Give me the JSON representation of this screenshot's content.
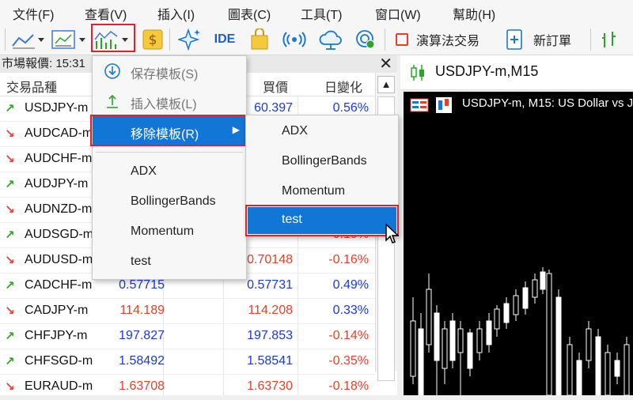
{
  "menubar": [
    "文件(F)",
    "查看(V)",
    "插入(I)",
    "圖表(C)",
    "工具(T)",
    "窗口(W)",
    "幫助(H)"
  ],
  "toolbar": {
    "ide_label": "IDE",
    "algo_label": "演算法交易",
    "new_order_label": "新訂單"
  },
  "market_watch": {
    "title": "市場報價: 15:31",
    "columns": [
      "交易品種",
      "買價",
      "日變化"
    ],
    "rows": [
      {
        "dir": "up",
        "symbol": "USDJPY-m",
        "bid": "",
        "ask": "60.397",
        "change": "0.56%",
        "bid_color": "blue",
        "change_color": "blue"
      },
      {
        "dir": "down",
        "symbol": "AUDCAD-m",
        "bid": "",
        "ask": "",
        "change": "",
        "bid_color": "red",
        "change_color": "red"
      },
      {
        "dir": "down",
        "symbol": "AUDCHF-m",
        "bid": "",
        "ask": "",
        "change": "",
        "bid_color": "red",
        "change_color": "red"
      },
      {
        "dir": "up",
        "symbol": "AUDJPY-m",
        "bid": "",
        "ask": "",
        "change": "",
        "bid_color": "blue",
        "change_color": "blue"
      },
      {
        "dir": "down",
        "symbol": "AUDNZD-m",
        "bid": "",
        "ask": "",
        "change": "",
        "bid_color": "red",
        "change_color": "red"
      },
      {
        "dir": "up",
        "symbol": "AUDSGD-m",
        "bid": "",
        "ask": "",
        "change": "0.19%",
        "bid_color": "blue",
        "change_color": "red"
      },
      {
        "dir": "down",
        "symbol": "AUDUSD-m",
        "bid": "",
        "ask": "0.70148",
        "change": "-0.16%",
        "bid_color": "red",
        "change_color": "red"
      },
      {
        "dir": "up",
        "symbol": "CADCHF-m",
        "bid": "0.57715",
        "ask": "0.57731",
        "change": "0.49%",
        "bid_color": "blue",
        "change_color": "blue"
      },
      {
        "dir": "down",
        "symbol": "CADJPY-m",
        "bid": "114.189",
        "ask": "114.208",
        "change": "0.33%",
        "bid_color": "red",
        "change_color": "blue"
      },
      {
        "dir": "up",
        "symbol": "CHFJPY-m",
        "bid": "197.827",
        "ask": "197.853",
        "change": "-0.14%",
        "bid_color": "blue",
        "change_color": "red"
      },
      {
        "dir": "up",
        "symbol": "CHFSGD-m",
        "bid": "1.58492",
        "ask": "1.58541",
        "change": "-0.35%",
        "bid_color": "blue",
        "change_color": "red"
      },
      {
        "dir": "down",
        "symbol": "EURAUD-m",
        "bid": "1.63708",
        "ask": "1.63730",
        "change": "-0.18%",
        "bid_color": "red",
        "change_color": "red"
      }
    ]
  },
  "template_menu": {
    "save": "保存模板(S)",
    "insert": "插入模板(L)",
    "remove": "移除模板(R)",
    "templates": [
      "ADX",
      "BollingerBands",
      "Momentum",
      "test"
    ]
  },
  "submenu": {
    "items": [
      "ADX",
      "BollingerBands",
      "Momentum",
      "test"
    ],
    "selected": "test"
  },
  "chart": {
    "tab_title": "USDJPY-m,M15",
    "header": "USDJPY-m, M15:  US Dollar vs J"
  },
  "colors": {
    "up": "#2aa52a",
    "down": "#e0432b",
    "bid_blue": "#1a3ad6",
    "highlight": "#1276d6",
    "annotation_red": "#e02030"
  }
}
